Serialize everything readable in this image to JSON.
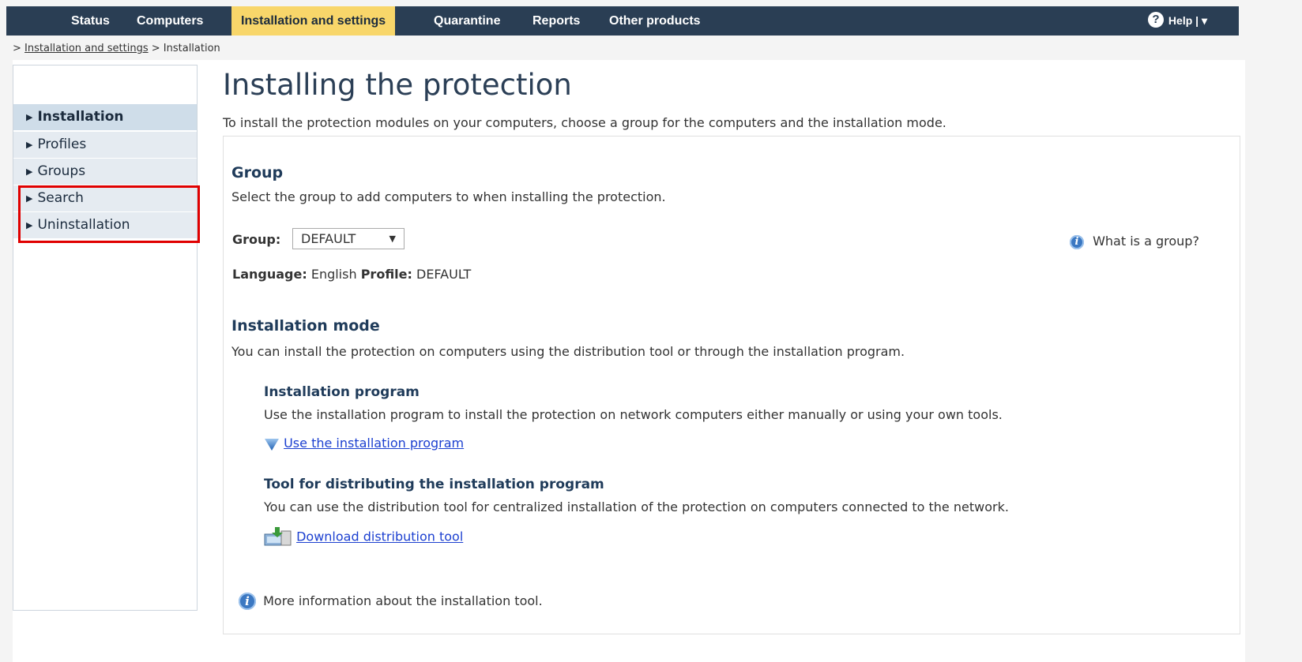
{
  "nav": {
    "tabs": [
      {
        "label": "Status"
      },
      {
        "label": "Computers"
      },
      {
        "label": "Installation and settings",
        "active": true
      },
      {
        "label": "Quarantine"
      },
      {
        "label": "Reports"
      },
      {
        "label": "Other products"
      }
    ],
    "help_label": "Help |",
    "help_arrow": "▾"
  },
  "breadcrumb": {
    "prefix": "> ",
    "link": "Installation and settings",
    "sep": " > ",
    "current": "Installation"
  },
  "sidebar": {
    "items": [
      {
        "label": "Installation",
        "active": true
      },
      {
        "label": "Profiles"
      },
      {
        "label": "Groups"
      },
      {
        "label": "Search"
      },
      {
        "label": "Uninstallation"
      }
    ]
  },
  "main": {
    "title": "Installing the protection",
    "intro": "To install the protection modules on your computers, choose a group for the computers and the installation mode.",
    "group": {
      "heading": "Group",
      "desc": "Select the group to add computers to when installing the protection.",
      "label": "Group:",
      "value": "DEFAULT",
      "help_link": "What is a group?",
      "language_label": "Language:",
      "language_value": "English",
      "profile_label": "Profile:",
      "profile_value": "DEFAULT"
    },
    "mode": {
      "heading": "Installation mode",
      "desc": "You can install the protection on computers using the distribution tool or through the installation program.",
      "program_heading": "Installation program",
      "program_desc": "Use the installation program to install the protection on network computers either manually or using your own tools.",
      "program_link": "Use the installation program",
      "tool_heading": "Tool for distributing the installation program",
      "tool_desc": "You can use the distribution tool for centralized installation of the protection on computers connected to the network.",
      "tool_link": "Download distribution tool",
      "more_info": "More information about the installation tool."
    }
  },
  "colors": {
    "topbar": "#2a3e54",
    "active_tab": "#f8d66a",
    "highlight": "#e00000",
    "link": "#1b3fd0"
  }
}
